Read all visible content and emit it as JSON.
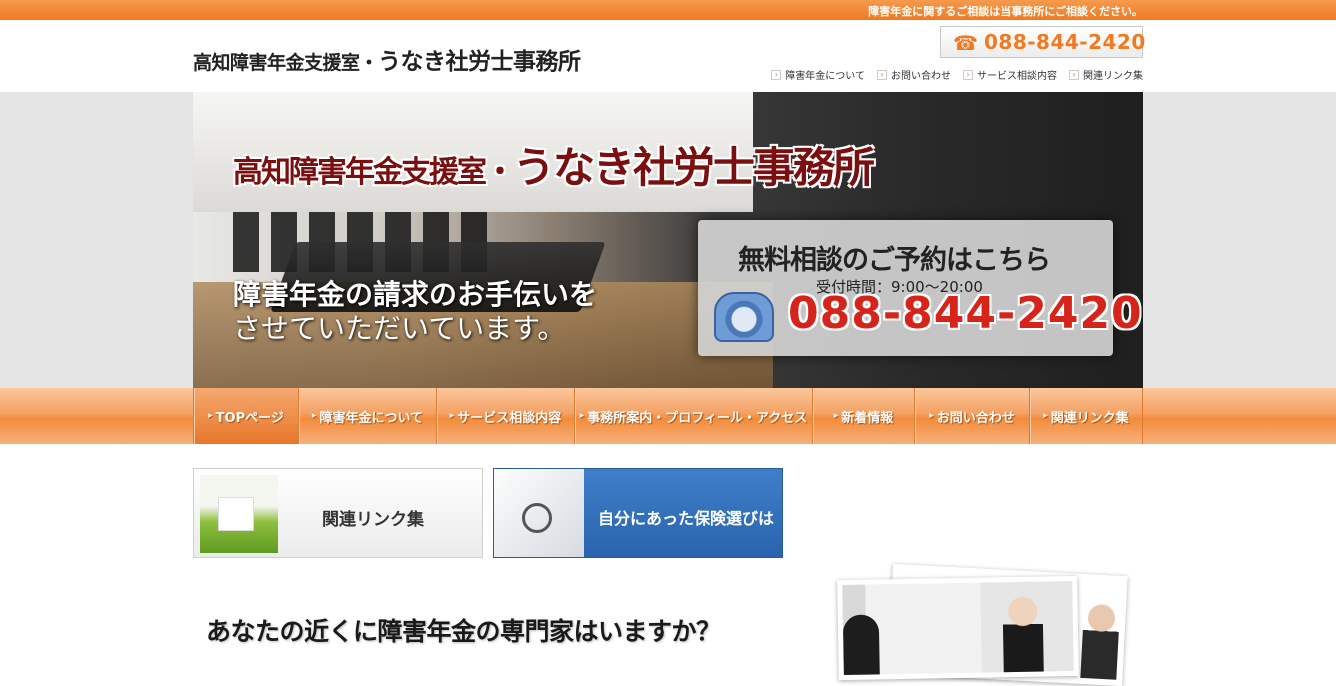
{
  "topbar": {
    "notice": "障害年金に関するご相談は当事務所にご相談ください。"
  },
  "header": {
    "title_prefix": "高知障害年金支援室・",
    "title_main": "うなき社労士事務所",
    "phone_icon": "phone-icon",
    "phone": "088-844-2420",
    "subnav": [
      "障害年金について",
      "お問い合わせ",
      "サービス相談内容",
      "関連リンク集"
    ]
  },
  "hero": {
    "title_prefix": "高知障害年金支援室・",
    "title_main": "うなき社労士事務所",
    "sub_line1": "障害年金の請求のお手伝いを",
    "sub_line2": "させていただいています。",
    "box_title": "無料相談のご予約はこちら",
    "box_hours": "受付時間：9:00～20:00",
    "box_phone": "088-844-2420"
  },
  "gnav": {
    "items": [
      "TOPページ",
      "障害年金について",
      "サービス相談内容",
      "事務所案内・プロフィール・アクセス",
      "新着情報",
      "お問い合わせ",
      "関連リンク集"
    ],
    "active_index": 0
  },
  "banners": {
    "links_label": "関連リンク集",
    "insurance_label": "自分にあった保険選びは"
  },
  "main": {
    "question": "あなたの近くに障害年金の専門家はいますか？"
  },
  "colors": {
    "accent": "#f07a22",
    "phone_red": "#d6241a",
    "banner_blue": "#2a63ad"
  }
}
